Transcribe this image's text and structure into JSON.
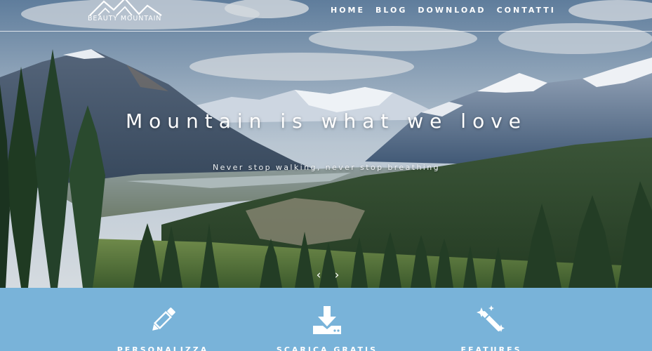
{
  "brand": {
    "name": "BEAUTY MOUNTAIN",
    "logo_icon": "mountain-logo-icon"
  },
  "nav": {
    "items": [
      {
        "label": "HOME"
      },
      {
        "label": "BLOG"
      },
      {
        "label": "DOWNLOAD"
      },
      {
        "label": "CONTATTI"
      }
    ]
  },
  "hero": {
    "headline": "Mountain is what we love",
    "subheadline": "Never stop walking, never stop breathing",
    "prev_icon": "chevron-left-icon",
    "next_icon": "chevron-right-icon",
    "prev_glyph": "‹",
    "next_glyph": "›"
  },
  "features": {
    "background": "#79b3d9",
    "items": [
      {
        "label": "PERSONALIZZA",
        "icon": "pencil-icon"
      },
      {
        "label": "SCARICA GRATIS",
        "icon": "download-icon"
      },
      {
        "label": "FEATURES",
        "icon": "magic-wand-icon"
      }
    ]
  }
}
